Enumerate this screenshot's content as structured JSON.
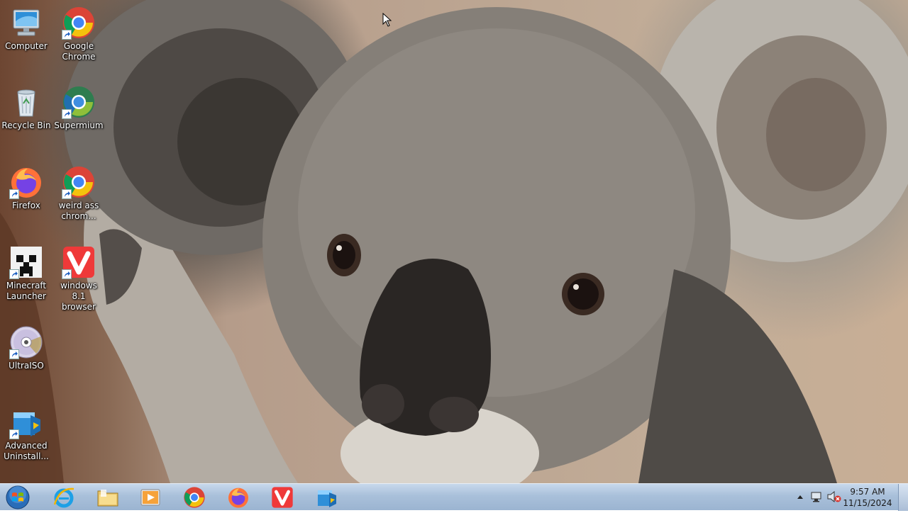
{
  "desktop": {
    "icons": [
      {
        "label": "Computer",
        "icon": "computer-icon"
      },
      {
        "label": "Google Chrome",
        "icon": "chrome-icon"
      },
      {
        "label": "Recycle Bin",
        "icon": "recycle-bin-icon"
      },
      {
        "label": "Supermium",
        "icon": "supermium-icon"
      },
      {
        "label": "Firefox",
        "icon": "firefox-icon"
      },
      {
        "label": "weird ass chrom...",
        "icon": "chrome-icon"
      },
      {
        "label": "Minecraft Launcher",
        "icon": "minecraft-icon"
      },
      {
        "label": "windows 8.1 browser",
        "icon": "vivaldi-icon"
      },
      {
        "label": "UltraISO",
        "icon": "disc-icon"
      },
      {
        "label": "Advanced Uninstall...",
        "icon": "uninstaller-icon"
      }
    ]
  },
  "taskbar": {
    "pinned": [
      {
        "icon": "internet-explorer-icon"
      },
      {
        "icon": "file-explorer-icon"
      },
      {
        "icon": "media-player-icon"
      },
      {
        "icon": "chrome-icon"
      },
      {
        "icon": "firefox-icon"
      },
      {
        "icon": "vivaldi-icon"
      },
      {
        "icon": "control-panel-icon"
      }
    ],
    "clock": {
      "time": "9:57 AM",
      "date": "11/15/2024"
    }
  },
  "colors": {
    "taskbar_top": "#c7d8ec",
    "taskbar_bottom": "#9bb4d1",
    "chrome_red": "#db4437",
    "chrome_yellow": "#f4c20d",
    "chrome_green": "#0f9d58",
    "chrome_blue": "#4285f4",
    "vivaldi_red": "#ef3939"
  }
}
